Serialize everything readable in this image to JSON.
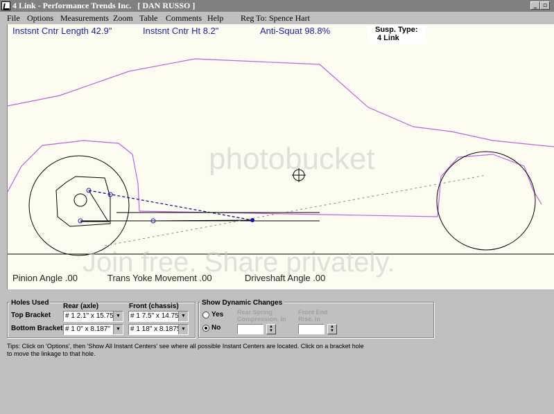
{
  "window": {
    "title": "4 Link - Performance Trends Inc.   [ DAN RUSSO ]",
    "controls": [
      "minimize-icon",
      "restore-icon",
      "close-icon"
    ]
  },
  "menu": {
    "items": [
      "File",
      "Options",
      "Measurements",
      "Zoom",
      "Table",
      "Comments",
      "Help"
    ],
    "reg": "Reg To: Spence Hart"
  },
  "readouts": {
    "instant_center_length": "Instsnt Cntr Length 42.9\"",
    "instant_center_height": "Instsnt Cntr Ht  8.2\"",
    "anti_squat": "Anti-Squat  98.8%",
    "susp_type_label": "Susp. Type:",
    "susp_type_value": "4 Link",
    "pinion_angle": "Pinion Angle  .00",
    "trans_yoke": "Trans Yoke Movement  .00",
    "driveshaft_angle": "Driveshaft Angle  .00"
  },
  "watermark": {
    "logo": "photobucket",
    "tagline": "Join free. Share privately."
  },
  "holes": {
    "group_label": "Holes Used",
    "rear_header": "Rear (axle)",
    "front_header": "Front (chassis)",
    "top_label": "Top Bracket",
    "bottom_label": "Bottom Bracket",
    "top_rear": "# 1    2.1\" x 15.75'",
    "top_front": "# 1    7.5\" x 14.75'",
    "bottom_rear": "# 1    0\" x 8.187\"",
    "bottom_front": "# 1    18\" x 8.1875"
  },
  "dynamic": {
    "group_label": "Show Dynamic Changes",
    "yes": "Yes",
    "no": "No",
    "selected": "No",
    "rear_spring_line1": "Rear Spring",
    "rear_spring_line2": "Compression, in",
    "front_end_line1": "Front End",
    "front_end_line2": "Rise, in"
  },
  "tips": "Tips:  Click on 'Options', then 'Show All Instant Centers' see where all possible Instant Centers are located.  Click on a bracket hole to move the linkage to that hole.",
  "colors": {
    "body_outline": "#c060e0",
    "readout_text": "#2020b0",
    "link_point": "#2020c0",
    "canvas_bg": "#fcfcf0",
    "window_bg": "#c0c0c0"
  }
}
